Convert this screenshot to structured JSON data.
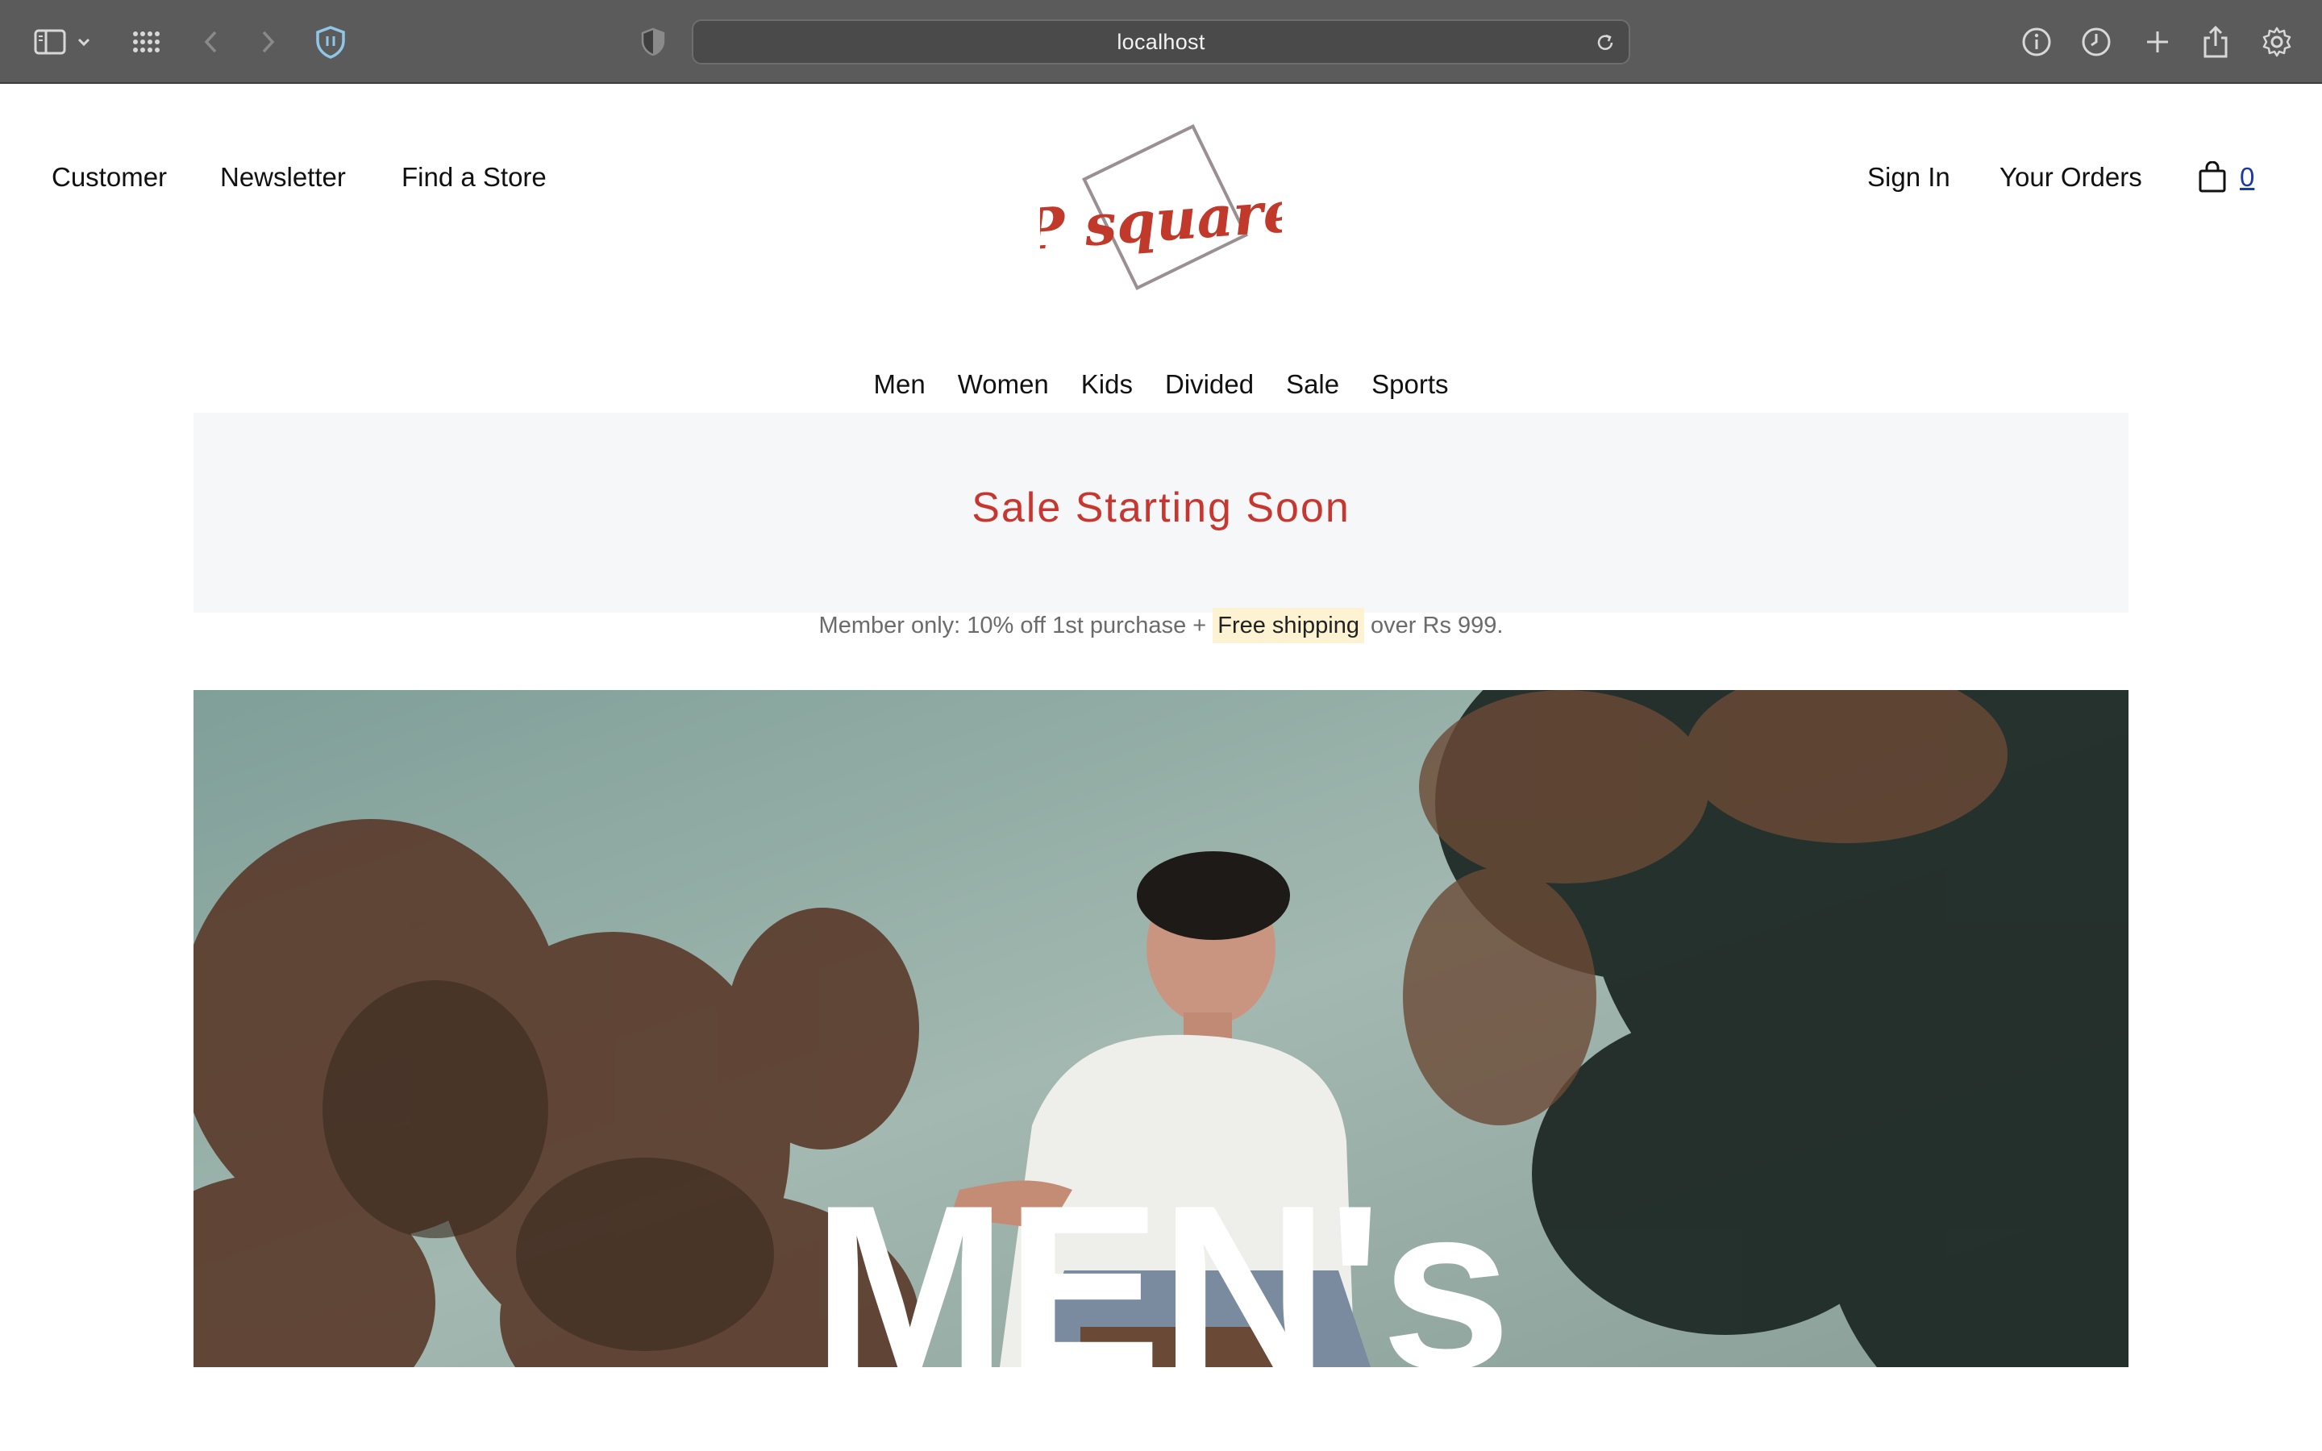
{
  "browser": {
    "url": "localhost",
    "toolbar_icons": [
      "sidebar-icon",
      "chevron-down-icon",
      "grid-icon",
      "back-icon",
      "forward-icon",
      "shield-icon",
      "privacy-icon",
      "info-icon",
      "history-icon",
      "plus-icon",
      "share-icon",
      "gear-icon"
    ]
  },
  "header": {
    "left_links": [
      "Customer",
      "Newsletter",
      "Find a Store"
    ],
    "logo_text": "P square",
    "right_links": [
      "Sign In",
      "Your Orders"
    ],
    "cart_count": "0"
  },
  "categories": [
    "Men",
    "Women",
    "Kids",
    "Divided",
    "Sale",
    "Sports"
  ],
  "sale": {
    "title": "Sale Starting Soon",
    "sub_before": "Member only: 10% off 1st purchase + ",
    "sub_highlight": "Free shipping",
    "sub_after": " over Rs 999."
  },
  "hero": {
    "title": "MEN's"
  },
  "colors": {
    "chrome": "#5b5b5b",
    "brand_red": "#c8372f",
    "banner_bg": "#f6f7f9",
    "highlight": "#fdf3d2"
  }
}
